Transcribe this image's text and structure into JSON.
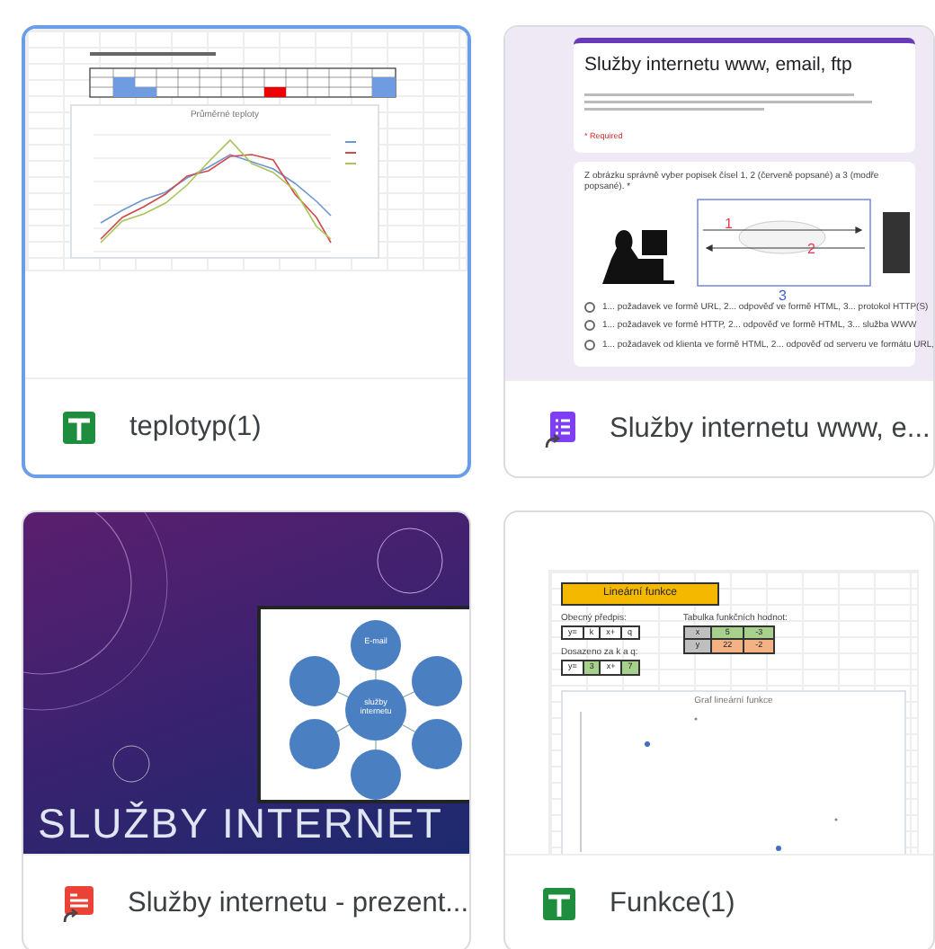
{
  "files": [
    {
      "name": "teplotyp(1)",
      "kind": "sheet",
      "selected": true,
      "shortcut": false,
      "preview": {
        "chart_title": "Průměrné teploty"
      }
    },
    {
      "name": "Služby internetu www, e...",
      "kind": "form",
      "selected": false,
      "shortcut": true,
      "preview": {
        "title": "Služby internetu www, email, ftp",
        "required": "* Required",
        "question": "Z obrázku správně vyber popisek čísel 1, 2 (červeně popsané) a 3 (modře popsané). *",
        "labels": [
          "1",
          "2",
          "3"
        ],
        "options": [
          {
            "label": "1... požadavek ve formě URL, 2... odpověď ve formě HTML, 3... protokol HTTP(S)",
            "selected": false
          },
          {
            "label": "1... požadavek ve formě HTTP, 2... odpověď ve formě HTML, 3... služba WWW",
            "selected": false
          },
          {
            "label": "1... požadavek od klienta ve formě HTML, 2... odpověď od serveru ve formátu URL,",
            "selected": false
          }
        ]
      }
    },
    {
      "name": "Služby internetu - prezent...",
      "kind": "pdf",
      "selected": false,
      "shortcut": true,
      "preview": {
        "center": "služby internetu",
        "top_node": "E-mail",
        "title": "SLUŽBY INTERNET"
      }
    },
    {
      "name": "Funkce(1)",
      "kind": "sheet2",
      "selected": false,
      "shortcut": false,
      "preview": {
        "title": "Lineární funkce",
        "general_label": "Obecný předpis:",
        "general": [
          "y=",
          "k",
          "x+",
          "q"
        ],
        "table_label": "Tabulka funkčních hodnot:",
        "table": [
          [
            "x",
            "5",
            "-3"
          ],
          [
            "y",
            "22",
            "-2"
          ]
        ],
        "subst_label": "Dosazeno za k a q:",
        "subst": [
          "y=",
          "3",
          "x+",
          "7"
        ],
        "chart_title": "Graf lineární funkce"
      }
    }
  ]
}
